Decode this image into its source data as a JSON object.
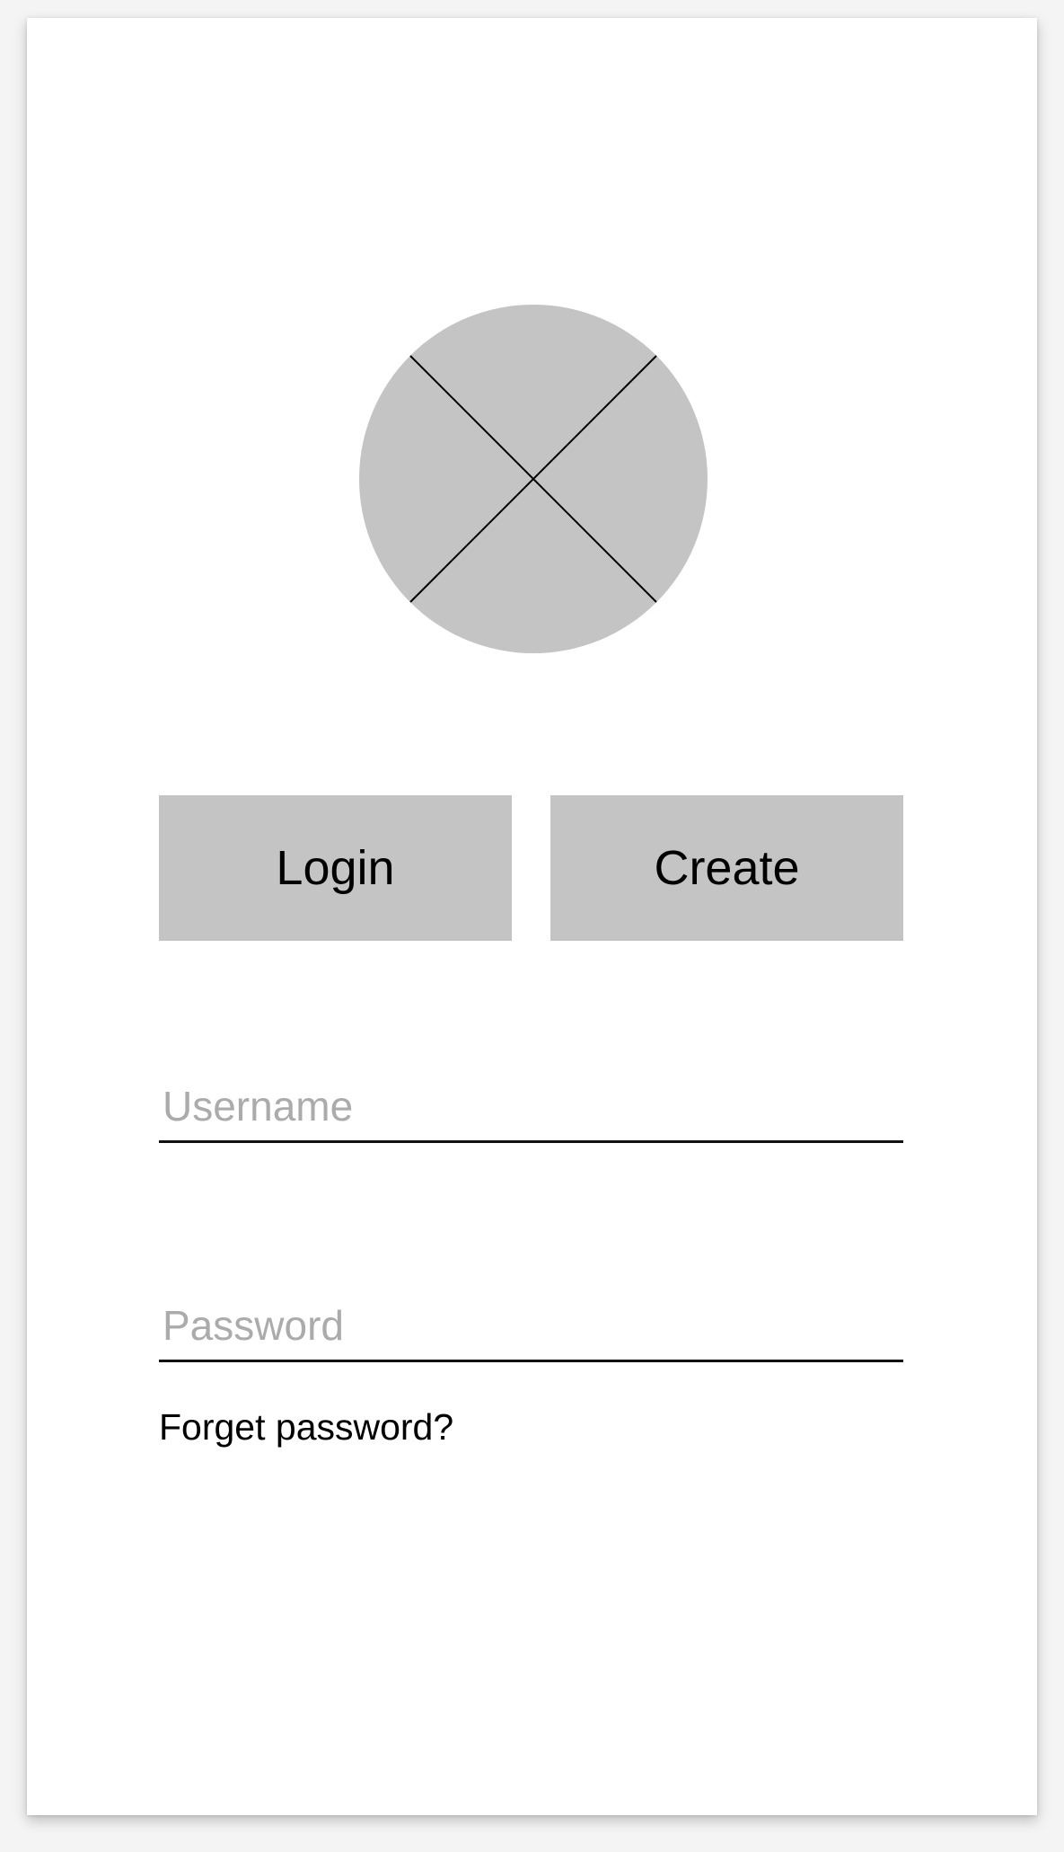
{
  "logo": {
    "icon": "image-placeholder-icon",
    "fill_color": "#c4c4c4",
    "line_color": "#000000"
  },
  "actions": {
    "login_label": "Login",
    "create_label": "Create",
    "button_color": "#c4c4c4"
  },
  "form": {
    "username": {
      "value": "",
      "placeholder": "Username"
    },
    "password": {
      "value": "",
      "placeholder": "Password"
    },
    "forgot_label": "Forget password?"
  }
}
